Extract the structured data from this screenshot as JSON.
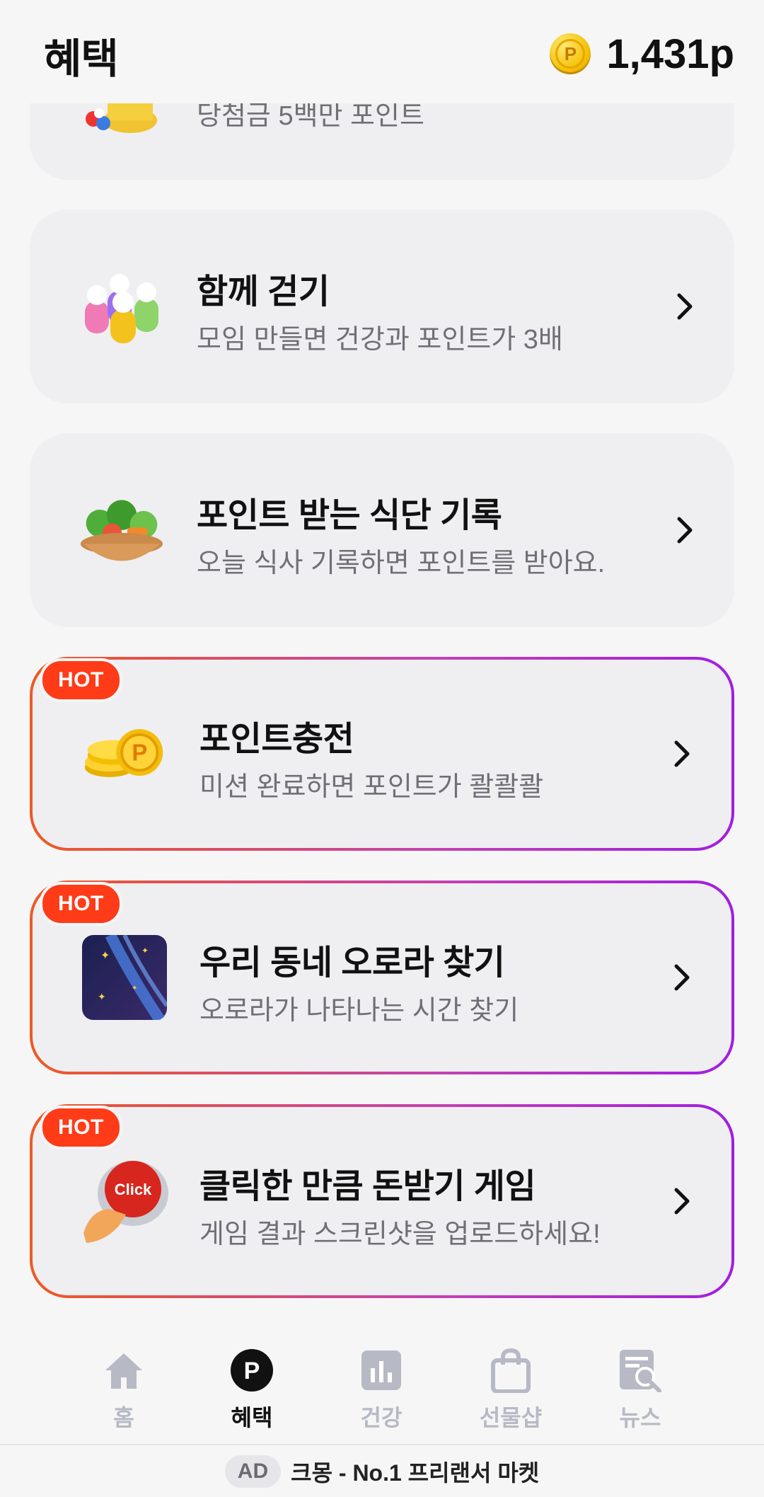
{
  "header": {
    "title": "혜택",
    "points": "1,431p",
    "coin_letter": "P"
  },
  "cards": [
    {
      "subtitle": "당첨금 5백만 포인트",
      "icon": "lottery-pot-icon"
    },
    {
      "title": "함께 걷기",
      "subtitle": "모임 만들면 건강과 포인트가 3배",
      "icon": "group-people-icon",
      "hot": false
    },
    {
      "title": "포인트 받는 식단 기록",
      "subtitle": "오늘 식사 기록하면 포인트를 받아요.",
      "icon": "food-basket-icon",
      "hot": false
    },
    {
      "title": "포인트충전",
      "subtitle": "미션 완료하면 포인트가 콸콸콸",
      "icon": "coin-stack-icon",
      "hot": true
    },
    {
      "title": "우리 동네 오로라 찾기",
      "subtitle": "오로라가 나타나는 시간 찾기",
      "icon": "aurora-icon",
      "hot": true
    },
    {
      "title": "클릭한 만큼 돈받기 게임",
      "subtitle": "게임 결과 스크린샷을 업로드하세요!",
      "icon": "click-button-icon",
      "hot": true,
      "icon_text": "Click"
    }
  ],
  "hot_label": "HOT",
  "nav": {
    "items": [
      {
        "label": "홈",
        "icon": "home-icon"
      },
      {
        "label": "혜택",
        "icon": "points-icon",
        "active": true,
        "icon_letter": "P"
      },
      {
        "label": "건강",
        "icon": "chart-icon"
      },
      {
        "label": "선물샵",
        "icon": "shopping-bag-icon"
      },
      {
        "label": "뉴스",
        "icon": "news-search-icon"
      }
    ]
  },
  "ad": {
    "tag": "AD",
    "text": "크몽 - No.1 프리랜서 마켓"
  },
  "colors": {
    "hot_badge": "#ff3b18",
    "border_start": "#ef5a22",
    "border_end": "#a21de0",
    "coin": "#f4c20a"
  }
}
